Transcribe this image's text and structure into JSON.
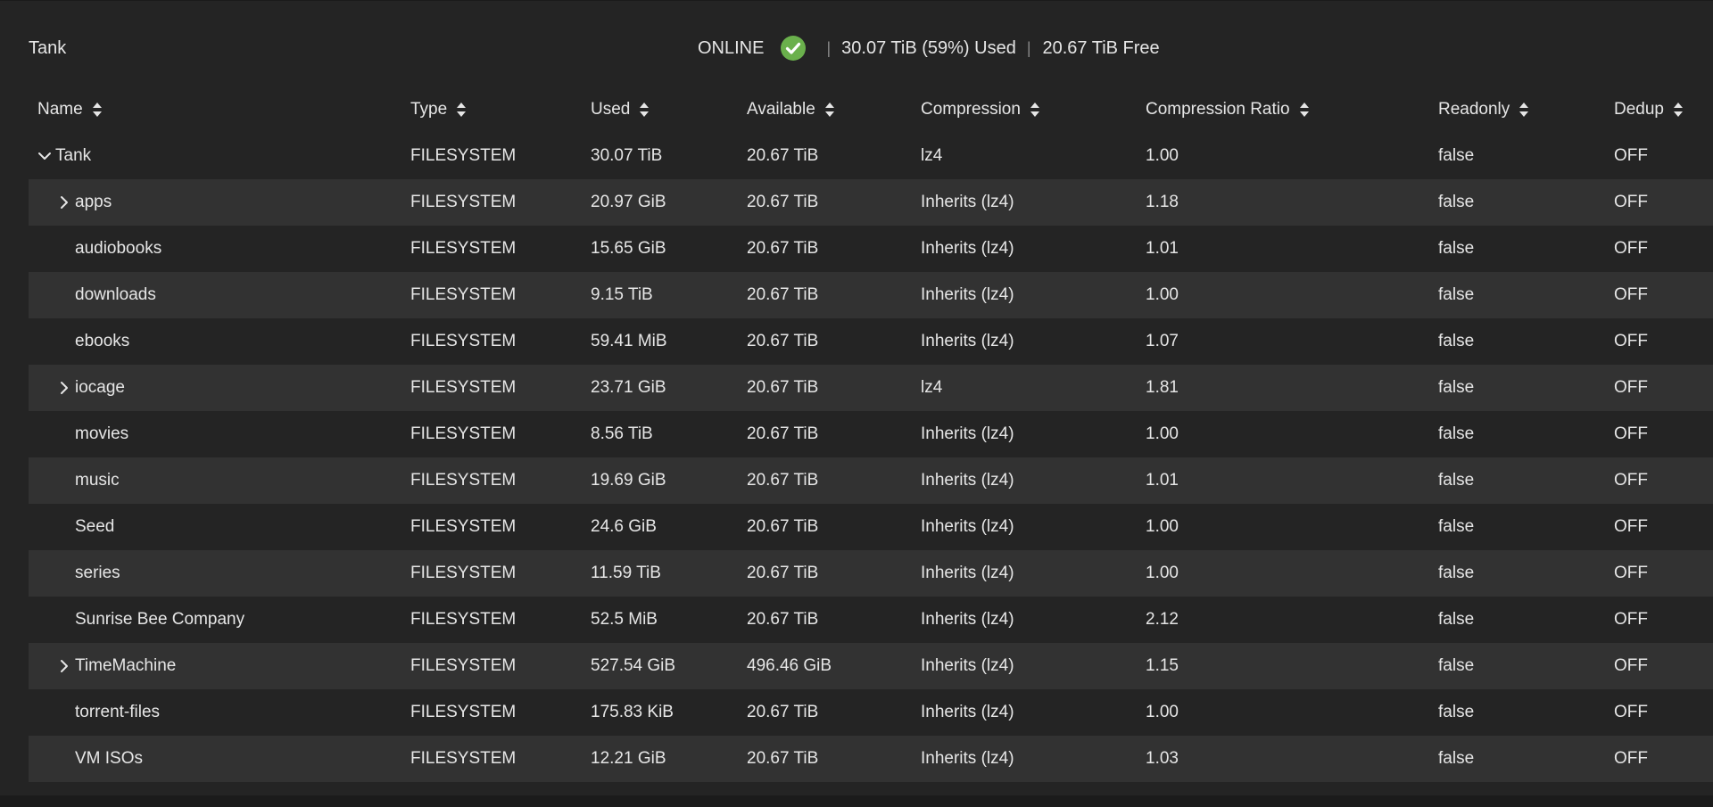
{
  "pool": {
    "name": "Tank",
    "status": "ONLINE",
    "status_icon": "check-circle-icon",
    "status_color": "#6ab04c",
    "used_summary": "30.07 TiB (59%) Used",
    "free_summary": "20.67 TiB Free",
    "separator": "|"
  },
  "table": {
    "headers": {
      "name": "Name",
      "type": "Type",
      "used": "Used",
      "available": "Available",
      "compression": "Compression",
      "compression_ratio": "Compression Ratio",
      "readonly": "Readonly",
      "dedup": "Dedup"
    },
    "rows": [
      {
        "name": "Tank",
        "expander": "expanded",
        "level": 0,
        "type": "FILESYSTEM",
        "used": "30.07 TiB",
        "available": "20.67 TiB",
        "compression": "lz4",
        "ratio": "1.00",
        "readonly": "false",
        "dedup": "OFF"
      },
      {
        "name": "apps",
        "expander": "collapsed",
        "level": 1,
        "type": "FILESYSTEM",
        "used": "20.97 GiB",
        "available": "20.67 TiB",
        "compression": "Inherits (lz4)",
        "ratio": "1.18",
        "readonly": "false",
        "dedup": "OFF"
      },
      {
        "name": "audiobooks",
        "expander": "none",
        "level": 1,
        "type": "FILESYSTEM",
        "used": "15.65 GiB",
        "available": "20.67 TiB",
        "compression": "Inherits (lz4)",
        "ratio": "1.01",
        "readonly": "false",
        "dedup": "OFF"
      },
      {
        "name": "downloads",
        "expander": "none",
        "level": 1,
        "type": "FILESYSTEM",
        "used": "9.15 TiB",
        "available": "20.67 TiB",
        "compression": "Inherits (lz4)",
        "ratio": "1.00",
        "readonly": "false",
        "dedup": "OFF"
      },
      {
        "name": "ebooks",
        "expander": "none",
        "level": 1,
        "type": "FILESYSTEM",
        "used": "59.41 MiB",
        "available": "20.67 TiB",
        "compression": "Inherits (lz4)",
        "ratio": "1.07",
        "readonly": "false",
        "dedup": "OFF"
      },
      {
        "name": "iocage",
        "expander": "collapsed",
        "level": 1,
        "type": "FILESYSTEM",
        "used": "23.71 GiB",
        "available": "20.67 TiB",
        "compression": "lz4",
        "ratio": "1.81",
        "readonly": "false",
        "dedup": "OFF"
      },
      {
        "name": "movies",
        "expander": "none",
        "level": 1,
        "type": "FILESYSTEM",
        "used": "8.56 TiB",
        "available": "20.67 TiB",
        "compression": "Inherits (lz4)",
        "ratio": "1.00",
        "readonly": "false",
        "dedup": "OFF"
      },
      {
        "name": "music",
        "expander": "none",
        "level": 1,
        "type": "FILESYSTEM",
        "used": "19.69 GiB",
        "available": "20.67 TiB",
        "compression": "Inherits (lz4)",
        "ratio": "1.01",
        "readonly": "false",
        "dedup": "OFF"
      },
      {
        "name": "Seed",
        "expander": "none",
        "level": 1,
        "type": "FILESYSTEM",
        "used": "24.6 GiB",
        "available": "20.67 TiB",
        "compression": "Inherits (lz4)",
        "ratio": "1.00",
        "readonly": "false",
        "dedup": "OFF"
      },
      {
        "name": "series",
        "expander": "none",
        "level": 1,
        "type": "FILESYSTEM",
        "used": "11.59 TiB",
        "available": "20.67 TiB",
        "compression": "Inherits (lz4)",
        "ratio": "1.00",
        "readonly": "false",
        "dedup": "OFF"
      },
      {
        "name": "Sunrise Bee Company",
        "expander": "none",
        "level": 1,
        "type": "FILESYSTEM",
        "used": "52.5 MiB",
        "available": "20.67 TiB",
        "compression": "Inherits (lz4)",
        "ratio": "2.12",
        "readonly": "false",
        "dedup": "OFF"
      },
      {
        "name": "TimeMachine",
        "expander": "collapsed",
        "level": 1,
        "type": "FILESYSTEM",
        "used": "527.54 GiB",
        "available": "496.46 GiB",
        "compression": "Inherits (lz4)",
        "ratio": "1.15",
        "readonly": "false",
        "dedup": "OFF"
      },
      {
        "name": "torrent-files",
        "expander": "none",
        "level": 1,
        "type": "FILESYSTEM",
        "used": "175.83 KiB",
        "available": "20.67 TiB",
        "compression": "Inherits (lz4)",
        "ratio": "1.00",
        "readonly": "false",
        "dedup": "OFF"
      },
      {
        "name": "VM ISOs",
        "expander": "none",
        "level": 1,
        "type": "FILESYSTEM",
        "used": "12.21 GiB",
        "available": "20.67 TiB",
        "compression": "Inherits (lz4)",
        "ratio": "1.03",
        "readonly": "false",
        "dedup": "OFF"
      }
    ]
  },
  "icons": {
    "sort": "sort-arrows-icon",
    "expanded": "chevron-down-icon",
    "collapsed": "chevron-right-icon"
  },
  "colors": {
    "background": "#242424",
    "row_alt": "#323232",
    "text": "#e6e6e6",
    "success": "#6ab04c"
  }
}
